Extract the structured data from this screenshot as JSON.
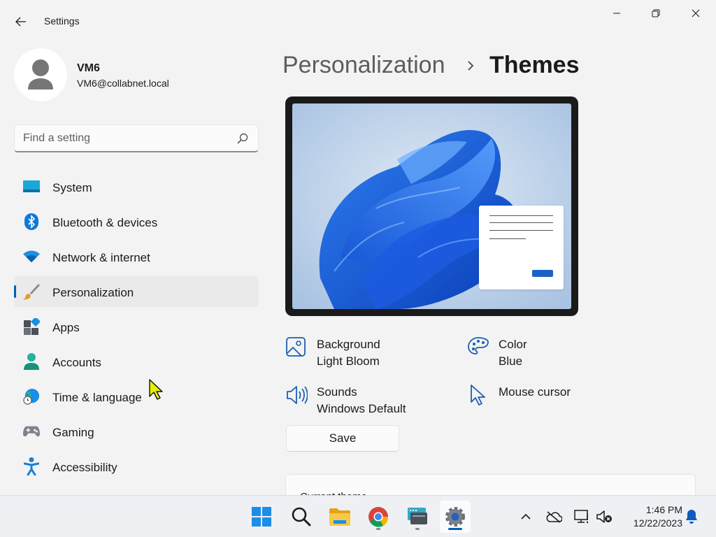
{
  "window": {
    "title": "Settings",
    "controls": [
      "minimize-icon",
      "restore-icon",
      "close-icon"
    ]
  },
  "user": {
    "name": "VM6",
    "email": "VM6@collabnet.local"
  },
  "search": {
    "placeholder": "Find a setting",
    "value": ""
  },
  "sidebar": {
    "items": [
      {
        "label": "System",
        "icon": "system-icon",
        "active": false
      },
      {
        "label": "Bluetooth & devices",
        "icon": "bluetooth-icon",
        "active": false
      },
      {
        "label": "Network & internet",
        "icon": "wifi-icon",
        "active": false
      },
      {
        "label": "Personalization",
        "icon": "paintbrush-icon",
        "active": true
      },
      {
        "label": "Apps",
        "icon": "apps-icon",
        "active": false
      },
      {
        "label": "Accounts",
        "icon": "accounts-icon",
        "active": false
      },
      {
        "label": "Time & language",
        "icon": "globe-clock-icon",
        "active": false
      },
      {
        "label": "Gaming",
        "icon": "gamepad-icon",
        "active": false
      },
      {
        "label": "Accessibility",
        "icon": "accessibility-icon",
        "active": false
      }
    ]
  },
  "header": {
    "parent": "Personalization",
    "current": "Themes"
  },
  "theme": {
    "background": {
      "title": "Background",
      "value": "Light Bloom"
    },
    "color": {
      "title": "Color",
      "value": "Blue"
    },
    "sounds": {
      "title": "Sounds",
      "value": "Windows Default"
    },
    "mouse_cursor": {
      "title": "Mouse cursor"
    },
    "save_label": "Save",
    "current_theme_label": "Current theme"
  },
  "colors": {
    "accent": "#005fb8",
    "bloom_blue": "#1a62c5",
    "window_bg": "#f3f3f3"
  },
  "taskbar": {
    "apps": [
      {
        "name": "start",
        "icon": "windows-start-icon",
        "active": false
      },
      {
        "name": "search",
        "icon": "search-icon",
        "active": false
      },
      {
        "name": "file-explorer",
        "icon": "folder-icon",
        "active": false,
        "running": false
      },
      {
        "name": "chrome",
        "icon": "chrome-icon",
        "active": false,
        "running": true
      },
      {
        "name": "remote-desktop",
        "icon": "remote-desktop-icon",
        "active": false,
        "running": true
      },
      {
        "name": "settings",
        "icon": "gear-icon",
        "active": true,
        "running": true
      }
    ],
    "tray": [
      "chevron-up-icon",
      "onedrive-offline-icon",
      "network-icon",
      "volume-muted-icon"
    ],
    "time": "1:46 PM",
    "date": "12/22/2023",
    "notification_icon": "bell-icon"
  }
}
